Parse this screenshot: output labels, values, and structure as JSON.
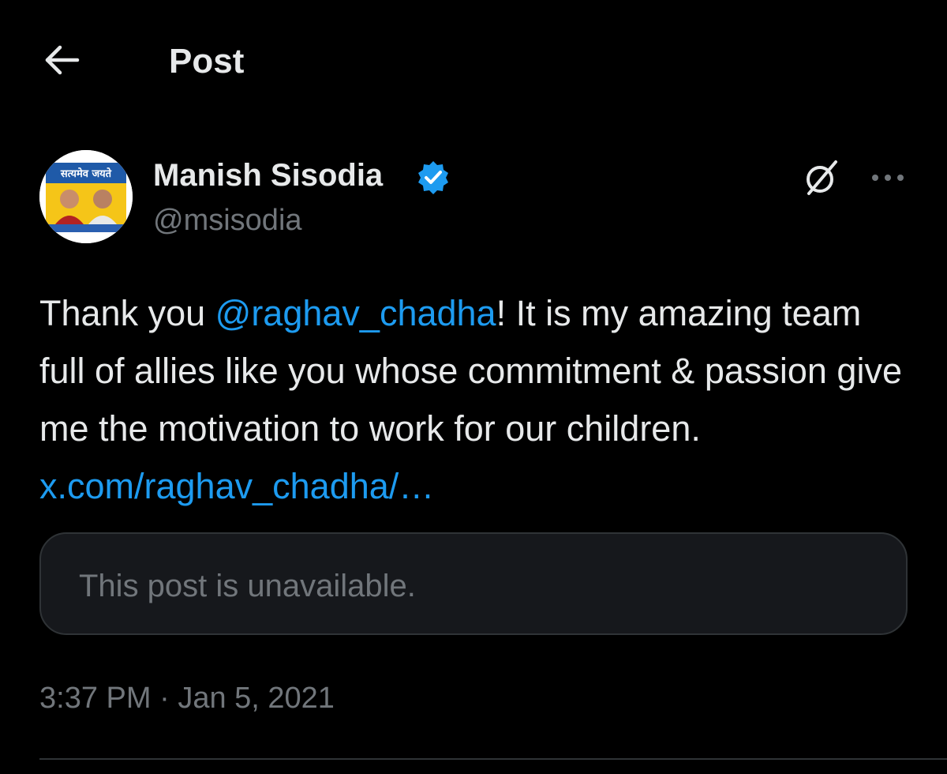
{
  "header": {
    "back_icon": "arrow-left-icon",
    "title": "Post"
  },
  "author": {
    "name": "Manish Sisodia",
    "handle": "@msisodia",
    "verified": true,
    "verified_color": "#1d9bf0",
    "avatar_banner_text": "सत्यमेव जयते",
    "avatar_banner_color": "#1f5aa8",
    "avatar_bg_color": "#f5c518"
  },
  "actions": {
    "grok_icon": "grok-icon",
    "more_icon": "more-horizontal-icon"
  },
  "post": {
    "text_part1": "Thank you ",
    "mention": "@raghav_chadha",
    "text_part2": "! It is my amazing team full of allies like you whose commitment & passion give me the motivation to work for our children. ",
    "link": "x.com/raghav_chadha/…"
  },
  "quote": {
    "text": "This post is unavailable."
  },
  "meta": {
    "time": "3:37 PM",
    "separator": " · ",
    "date": "Jan 5, 2021"
  },
  "colors": {
    "background": "#000000",
    "text_primary": "#e7e9ea",
    "text_secondary": "#71767b",
    "accent": "#1d9bf0",
    "card_bg": "#16181c",
    "border": "#2f3336"
  }
}
